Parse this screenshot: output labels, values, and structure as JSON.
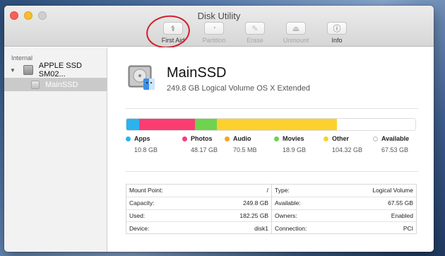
{
  "window": {
    "title": "Disk Utility"
  },
  "toolbar": {
    "items": [
      {
        "label": "First Aid",
        "icon": "stethoscope-icon",
        "glyph": "⚕",
        "enabled": true
      },
      {
        "label": "Partition",
        "icon": "partition-icon",
        "glyph": "◔",
        "enabled": false
      },
      {
        "label": "Erase",
        "icon": "erase-icon",
        "glyph": "✎",
        "enabled": false
      },
      {
        "label": "Unmount",
        "icon": "eject-icon",
        "glyph": "⏏",
        "enabled": false
      },
      {
        "label": "Info",
        "icon": "info-icon",
        "glyph": "ⓘ",
        "enabled": true
      }
    ]
  },
  "sidebar": {
    "section": "Internal",
    "disk": {
      "name": "APPLE SSD SM02..."
    },
    "volume": {
      "name": "MainSSD"
    }
  },
  "volume": {
    "name": "MainSSD",
    "description": "249.8 GB Logical Volume OS X Extended"
  },
  "usage": {
    "categories": [
      {
        "name": "Apps",
        "size": "10.8 GB",
        "gb": 10.8,
        "color": "#2ab3ee"
      },
      {
        "name": "Photos",
        "size": "48.17 GB",
        "gb": 48.17,
        "color": "#f93d73"
      },
      {
        "name": "Audio",
        "size": "70.5 MB",
        "gb": 0.07,
        "color": "#f6a223"
      },
      {
        "name": "Movies",
        "size": "18.9 GB",
        "gb": 18.9,
        "color": "#6fd24f"
      },
      {
        "name": "Other",
        "size": "104.32 GB",
        "gb": 104.32,
        "color": "#fcd12d"
      },
      {
        "name": "Available",
        "size": "67.53 GB",
        "gb": 67.53,
        "color": "#ffffff"
      }
    ]
  },
  "info": {
    "left": [
      {
        "label": "Mount Point:",
        "value": "/"
      },
      {
        "label": "Capacity:",
        "value": "249.8 GB"
      },
      {
        "label": "Used:",
        "value": "182.25 GB"
      },
      {
        "label": "Device:",
        "value": "disk1"
      }
    ],
    "right": [
      {
        "label": "Type:",
        "value": "Logical Volume"
      },
      {
        "label": "Available:",
        "value": "67.55 GB"
      },
      {
        "label": "Owners:",
        "value": "Enabled"
      },
      {
        "label": "Connection:",
        "value": "PCI"
      }
    ]
  }
}
